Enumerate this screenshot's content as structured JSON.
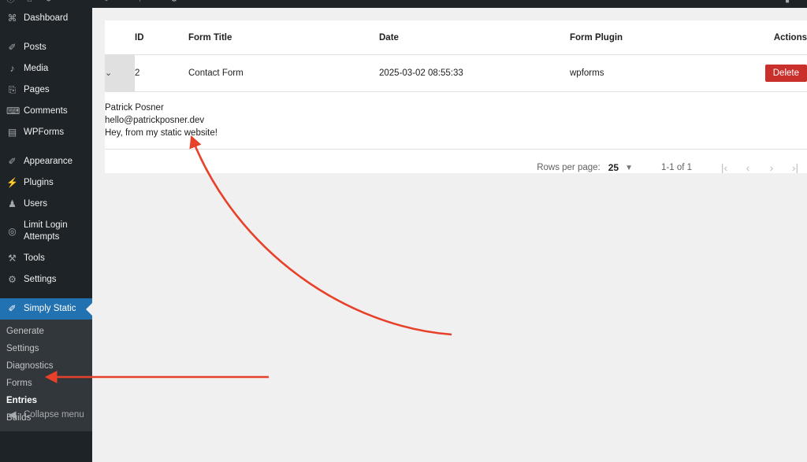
{
  "adminbar": {
    "glyphs": [
      "ⓘ",
      "⌂",
      "⟳",
      "✐",
      "⚑",
      "⚙",
      "▮"
    ]
  },
  "sidebar": {
    "items": [
      {
        "icon": "dashboard-icon",
        "glyph": "⌘",
        "label": "Dashboard",
        "sep_after": true
      },
      {
        "icon": "posts-icon",
        "glyph": "✐",
        "label": "Posts",
        "sep_after": false
      },
      {
        "icon": "media-icon",
        "glyph": "♪",
        "label": "Media",
        "sep_after": false
      },
      {
        "icon": "pages-icon",
        "glyph": "⎘",
        "label": "Pages",
        "sep_after": false
      },
      {
        "icon": "comments-icon",
        "glyph": "⌨",
        "label": "Comments",
        "sep_after": false
      },
      {
        "icon": "wpforms-icon",
        "glyph": "▤",
        "label": "WPForms",
        "sep_after": true
      },
      {
        "icon": "appearance-icon",
        "glyph": "✐",
        "label": "Appearance",
        "sep_after": false
      },
      {
        "icon": "plugins-icon",
        "glyph": "⚡",
        "label": "Plugins",
        "sep_after": false
      },
      {
        "icon": "users-icon",
        "glyph": "♟",
        "label": "Users",
        "sep_after": false
      },
      {
        "icon": "limit-login-attempts-icon",
        "glyph": "◎",
        "label": "Limit Login Attempts",
        "sep_after": false
      },
      {
        "icon": "tools-icon",
        "glyph": "⚒",
        "label": "Tools",
        "sep_after": false
      },
      {
        "icon": "settings-icon",
        "glyph": "⚙",
        "label": "Settings",
        "sep_after": false
      }
    ],
    "current": {
      "icon": "simply-static-icon",
      "glyph": "✐",
      "label": "Simply Static"
    },
    "submenu": [
      {
        "label": "Generate",
        "active": false
      },
      {
        "label": "Settings",
        "active": false
      },
      {
        "label": "Diagnostics",
        "active": false
      },
      {
        "label": "Forms",
        "active": false
      },
      {
        "label": "Entries",
        "active": true
      },
      {
        "label": "Builds",
        "active": false
      }
    ],
    "collapse": {
      "icon": "collapse-menu-icon",
      "glyph": "◀",
      "label": "Collapse menu"
    }
  },
  "table": {
    "columns": [
      "",
      "ID",
      "Form Title",
      "Date",
      "Form Plugin",
      "Actions"
    ],
    "rows": [
      {
        "expand_glyph": "⌄",
        "id": "2",
        "form_title": "Contact Form",
        "date": "2025-03-02 08:55:33",
        "form_plugin": "wpforms",
        "action_label": "Delete",
        "detail": [
          "Patrick Posner",
          "hello@patrickposner.dev",
          "Hey, from my static website!"
        ]
      }
    ]
  },
  "pagination": {
    "rows_per_page_label": "Rows per page:",
    "rows_per_page_value": "25",
    "caret_glyph": "▼",
    "range": "1-1 of 1",
    "first_glyph": "|‹",
    "prev_glyph": "‹",
    "next_glyph": "›",
    "last_glyph": "›|"
  },
  "annotations": {
    "color": "#e8412a",
    "curved_arrow": "points from pagination area up-left to entry detail",
    "straight_arrow": "points left to Entries submenu item"
  },
  "colors": {
    "sidebar_bg": "#1d2327",
    "submenu_bg": "#32373c",
    "accent_blue": "#2271b1",
    "delete_red": "#c9302c",
    "content_bg": "#f0f0f1",
    "card_bg": "#ffffff",
    "annotation_red": "#e8412a"
  }
}
